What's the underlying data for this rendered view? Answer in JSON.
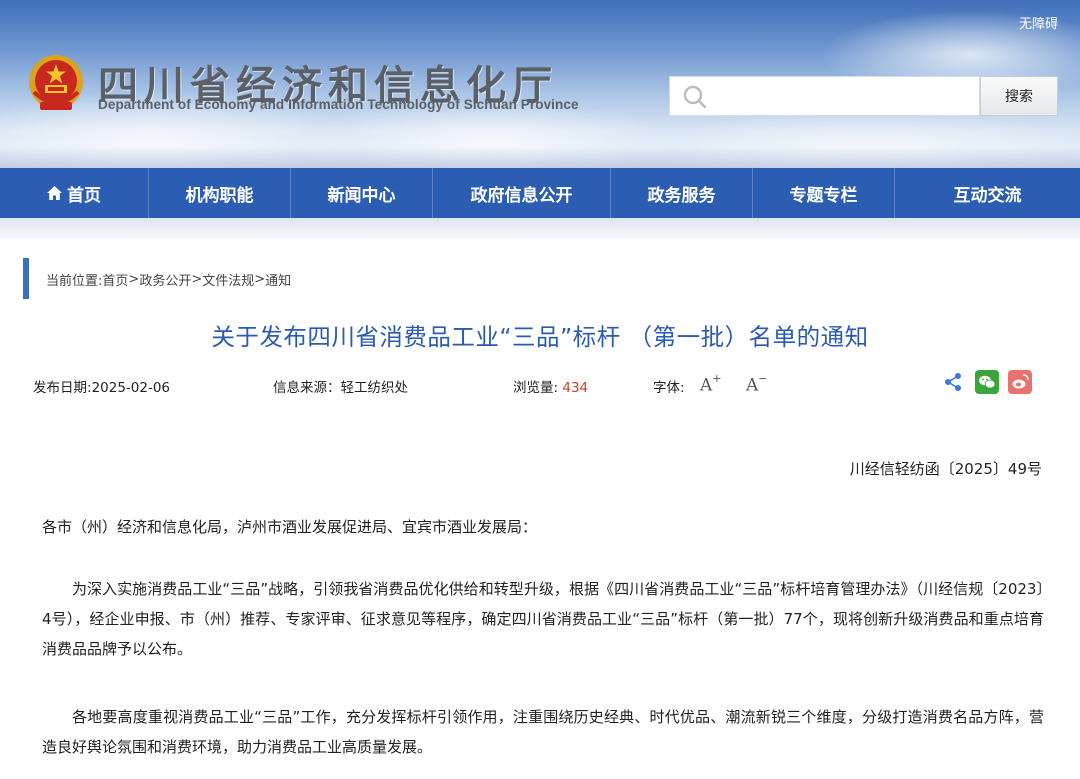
{
  "header": {
    "accessibility_label": "无障碍",
    "site_title": "四川省经济和信息化厅",
    "site_subtitle": "Department of Economy and Information Technology of Sichuan Province",
    "search": {
      "value": "",
      "placeholder": "",
      "button_label": "搜索"
    }
  },
  "nav": {
    "items": [
      {
        "label": "首页",
        "icon": "home-icon"
      },
      {
        "label": "机构职能"
      },
      {
        "label": "新闻中心"
      },
      {
        "label": "政府信息公开"
      },
      {
        "label": "政务服务"
      },
      {
        "label": "专题专栏"
      },
      {
        "label": "互动交流"
      }
    ]
  },
  "breadcrumb": {
    "prefix": "当前位置:",
    "items": [
      "首页",
      "政务公开",
      "文件法规",
      "通知"
    ],
    "separator": ">"
  },
  "article": {
    "title": "关于发布四川省消费品工业“三品”标杆 （第一批）名单的通知",
    "meta": {
      "date_label": "发布日期:",
      "date": "2025-02-06",
      "source_label": "信息来源：",
      "source": "轻工纺织处",
      "views_label": "浏览量:",
      "views": "434",
      "font_label": "字体:",
      "font_increase": "A",
      "font_decrease": "A"
    },
    "doc_number": "川经信轻纺函〔2025〕49号",
    "addressee": "各市（州）经济和信息化局，泸州市酒业发展促进局、宜宾市酒业发展局：",
    "paragraphs": [
      "为深入实施消费品工业“三品”战略，引领我省消费品优化供给和转型升级，根据《四川省消费品工业“三品”标杆培育管理办法》（川经信规〔2023〕4号），经企业申报、市（州）推荐、专家评审、征求意见等程序，确定四川省消费品工业“三品”标杆（第一批）77个，现将创新升级消费品和重点培育消费品品牌予以公布。",
      "各地要高度重视消费品工业“三品”工作，充分发挥标杆引领作用，注重围绕历史经典、时代优品、潮流新锐三个维度，分级打造消费名品方阵，营造良好舆论氛围和消费环境，助力消费品工业高质量发展。"
    ]
  },
  "colors": {
    "nav_bg": "#2b5db2",
    "title_blue": "#2a5bb0",
    "views_red": "#d43b2c",
    "wechat_green": "#3aa53a",
    "weibo_red": "#e8726d"
  }
}
